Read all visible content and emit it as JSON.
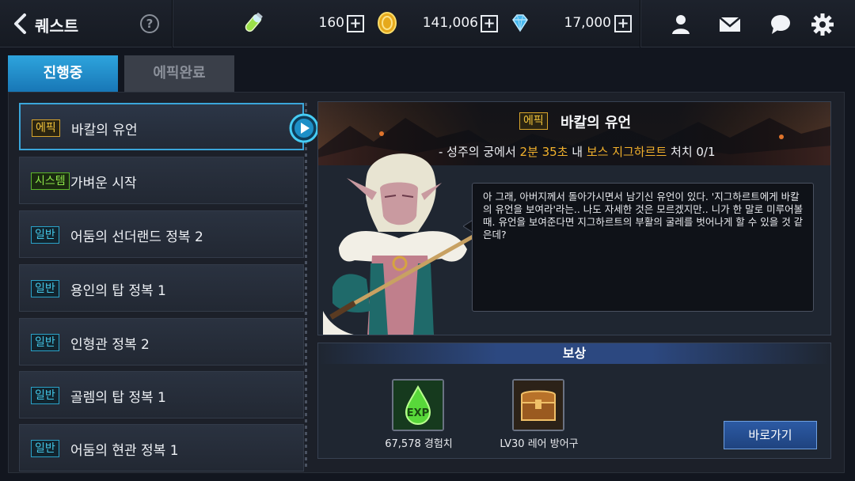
{
  "header": {
    "title": "퀘스트",
    "help": "?",
    "resources": [
      {
        "icon": "stamina-potion-icon",
        "value": "160"
      },
      {
        "icon": "gold-coin-icon",
        "value": "141,006"
      },
      {
        "icon": "diamond-gem-icon",
        "value": "17,000"
      }
    ],
    "plus": "+"
  },
  "tabs": [
    {
      "label": "진행중",
      "active": true
    },
    {
      "label": "에픽완료",
      "active": false
    }
  ],
  "quests": [
    {
      "tag": "에픽",
      "type": "epic",
      "name": "바칼의 유언",
      "selected": true
    },
    {
      "tag": "시스템",
      "type": "system",
      "name": "가벼운 시작"
    },
    {
      "tag": "일반",
      "type": "normal",
      "name": "어둠의 선더랜드 정복 2"
    },
    {
      "tag": "일반",
      "type": "normal",
      "name": "용인의 탑 정복 1"
    },
    {
      "tag": "일반",
      "type": "normal",
      "name": "인형관 정복 2"
    },
    {
      "tag": "일반",
      "type": "normal",
      "name": "골렘의 탑 정복 1"
    },
    {
      "tag": "일반",
      "type": "normal",
      "name": "어둠의 현관 정복 1"
    }
  ],
  "detail": {
    "tag": "에픽",
    "title": "바칼의 유언",
    "objective": {
      "prefix": "- 성주의 궁에서 ",
      "time": "2분 35초",
      "mid": " 내 ",
      "target": "보스 지그하르트",
      "suffix": " 처치 0/1"
    },
    "dialog": "아 그래, 아버지께서 돌아가시면서 남기신 유언이 있다. '지그하르트에게 바칼의 유언을 보여라'라는.. 나도 자세한 것은 모르겠지만.. 니가 한 말로 미루어볼 때. 유언을 보여준다면 지그하르트의 부활의 굴레를 벗어나게 할 수 있을 것 같은데?"
  },
  "rewards": {
    "header": "보상",
    "items": [
      {
        "icon": "exp-drop-icon",
        "label": "67,578 경험치"
      },
      {
        "icon": "treasure-chest-icon",
        "label": "LV30 레어 방어구"
      }
    ],
    "goto_label": "바로가기"
  },
  "colors": {
    "accent": "#2ea4dd",
    "epic": "#f0c23a",
    "system": "#8ee84a",
    "normal": "#43c6e6",
    "highlight": "#f2b12c"
  }
}
